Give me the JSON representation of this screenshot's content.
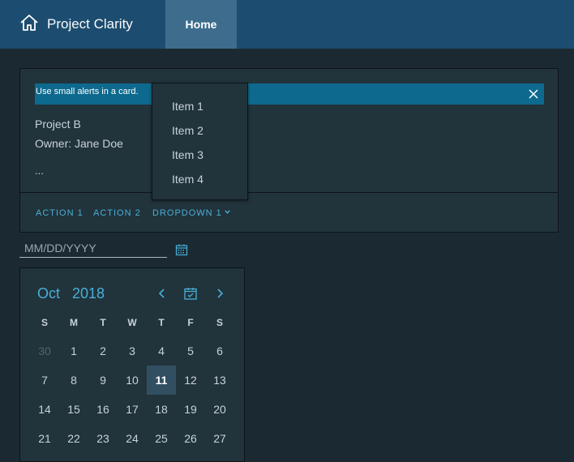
{
  "header": {
    "app_title": "Project Clarity",
    "nav_home": "Home",
    "brand_icon": "home-icon",
    "colors": {
      "header_bg": "#1c4d70",
      "active_nav": "#3e6c8c"
    }
  },
  "card": {
    "alert": {
      "text": "Use small alerts in a card.",
      "close_icon": "close-icon"
    },
    "project_name": "Project B",
    "owner": "Owner: Jane Doe",
    "ellipsis": "...",
    "actions": [
      "ACTION 1",
      "ACTION 2",
      "DROPDOWN 1"
    ]
  },
  "dropdown_menu": {
    "items": [
      "Item 1",
      "Item 2",
      "Item 3",
      "Item 4"
    ]
  },
  "datepicker": {
    "placeholder": "MM/DD/YYYY",
    "toggle_icon": "calendar-icon"
  },
  "calendar": {
    "month": "Oct",
    "year": "2018",
    "weekdays": [
      "S",
      "M",
      "T",
      "W",
      "T",
      "F",
      "S"
    ],
    "weeks": [
      [
        "30",
        "1",
        "2",
        "3",
        "4",
        "5",
        "6"
      ],
      [
        "7",
        "8",
        "9",
        "10",
        "11",
        "12",
        "13"
      ],
      [
        "14",
        "15",
        "16",
        "17",
        "18",
        "19",
        "20"
      ],
      [
        "21",
        "22",
        "23",
        "24",
        "25",
        "26",
        "27"
      ]
    ],
    "today": "11",
    "icons": [
      "chevron-left-icon",
      "calendar-check-icon",
      "chevron-right-icon"
    ],
    "accent_color": "#49afd9"
  }
}
